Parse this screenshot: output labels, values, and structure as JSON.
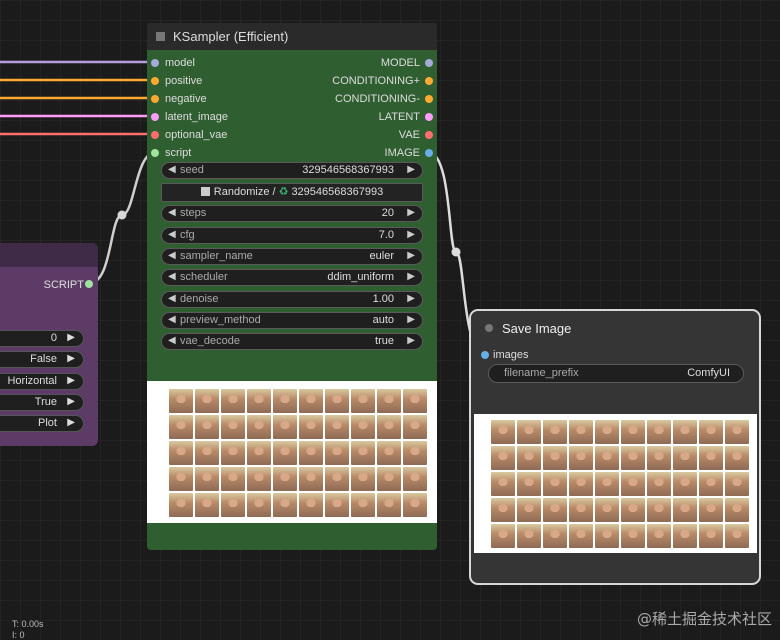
{
  "wire_colors": {
    "model": "#b39ddb",
    "positive": "#ffa931",
    "negative": "#ffa931",
    "latent_image": "#ff9cf9",
    "optional_vae": "#ff6e6e",
    "script": "#cccccc",
    "image": "#cccccc"
  },
  "left_node": {
    "output_label": "SCRIPT",
    "widgets": [
      {
        "value": "0"
      },
      {
        "value": "False"
      },
      {
        "value": "Horizontal"
      },
      {
        "value": "True"
      },
      {
        "value": "Plot"
      }
    ]
  },
  "ksampler": {
    "title": "KSampler (Efficient)",
    "inputs": [
      {
        "label": "model",
        "color": "#a7a9d8"
      },
      {
        "label": "positive",
        "color": "#ffa931"
      },
      {
        "label": "negative",
        "color": "#ffa931"
      },
      {
        "label": "latent_image",
        "color": "#ff9cf9"
      },
      {
        "label": "optional_vae",
        "color": "#ff6e6e"
      },
      {
        "label": "script",
        "color": "#9fe39f"
      }
    ],
    "outputs": [
      {
        "label": "MODEL",
        "color": "#a7a9d8"
      },
      {
        "label": "CONDITIONING+",
        "color": "#ffa931"
      },
      {
        "label": "CONDITIONING-",
        "color": "#ffa931"
      },
      {
        "label": "LATENT",
        "color": "#ff9cf9"
      },
      {
        "label": "VAE",
        "color": "#ff6e6e"
      },
      {
        "label": "IMAGE",
        "color": "#66aee8"
      }
    ],
    "randomize_button": {
      "prefix": "Randomize /",
      "value": "329546568367993"
    },
    "widgets": [
      {
        "name": "seed",
        "value": "329546568367993"
      },
      {
        "name": "steps",
        "value": "20"
      },
      {
        "name": "cfg",
        "value": "7.0"
      },
      {
        "name": "sampler_name",
        "value": "euler"
      },
      {
        "name": "scheduler",
        "value": "ddim_uniform"
      },
      {
        "name": "denoise",
        "value": "1.00"
      },
      {
        "name": "preview_method",
        "value": "auto"
      },
      {
        "name": "vae_decode",
        "value": "true"
      }
    ]
  },
  "save_image": {
    "title": "Save Image",
    "input_label": "images",
    "widget": {
      "name": "filename_prefix",
      "value": "ComfyUI"
    }
  },
  "status": {
    "line1": "T: 0.00s",
    "line2": "I: 0"
  },
  "watermark": "@稀土掘金技术社区"
}
